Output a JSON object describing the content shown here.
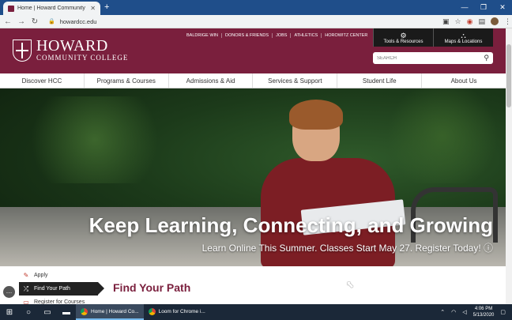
{
  "browser": {
    "tab_title": "Home | Howard Community Colle",
    "url": "howardcc.edu",
    "window_controls": [
      "—",
      "❐",
      "✕"
    ]
  },
  "site": {
    "logo_line1": "HOWARD",
    "logo_line2": "COMMUNITY COLLEGE",
    "toplinks": [
      "BALDRIGE WIN",
      "DONORS & FRIENDS",
      "JOBS",
      "ATHLETICS",
      "HOROWITZ CENTER"
    ],
    "tools": [
      {
        "label": "Tools & Resources",
        "icon": "gear-icon"
      },
      {
        "label": "Maps & Locations",
        "icon": "map-icon"
      }
    ],
    "search_placeholder": "SEARCH",
    "nav": [
      "Discover HCC",
      "Programs & Courses",
      "Admissions & Aid",
      "Services & Support",
      "Student Life",
      "About Us"
    ]
  },
  "hero": {
    "title": "Keep Learning, Connecting, and Growing",
    "subtitle": "Learn Online This Summer. Classes Start May 27. Register Today! ⓘ"
  },
  "quick_links": [
    {
      "label": "Apply",
      "icon": "edit-icon"
    },
    {
      "label": "Find Your Path",
      "icon": "shuffle-icon"
    },
    {
      "label": "Register for Courses",
      "icon": "calendar-icon"
    }
  ],
  "panel": {
    "title": "Find Your Path"
  },
  "taskbar": {
    "apps": [
      {
        "label": "Home | Howard Co...",
        "active": true
      },
      {
        "label": "Loom for Chrome i...",
        "active": false
      }
    ],
    "time": "4:06 PM",
    "date": "5/13/2020"
  }
}
